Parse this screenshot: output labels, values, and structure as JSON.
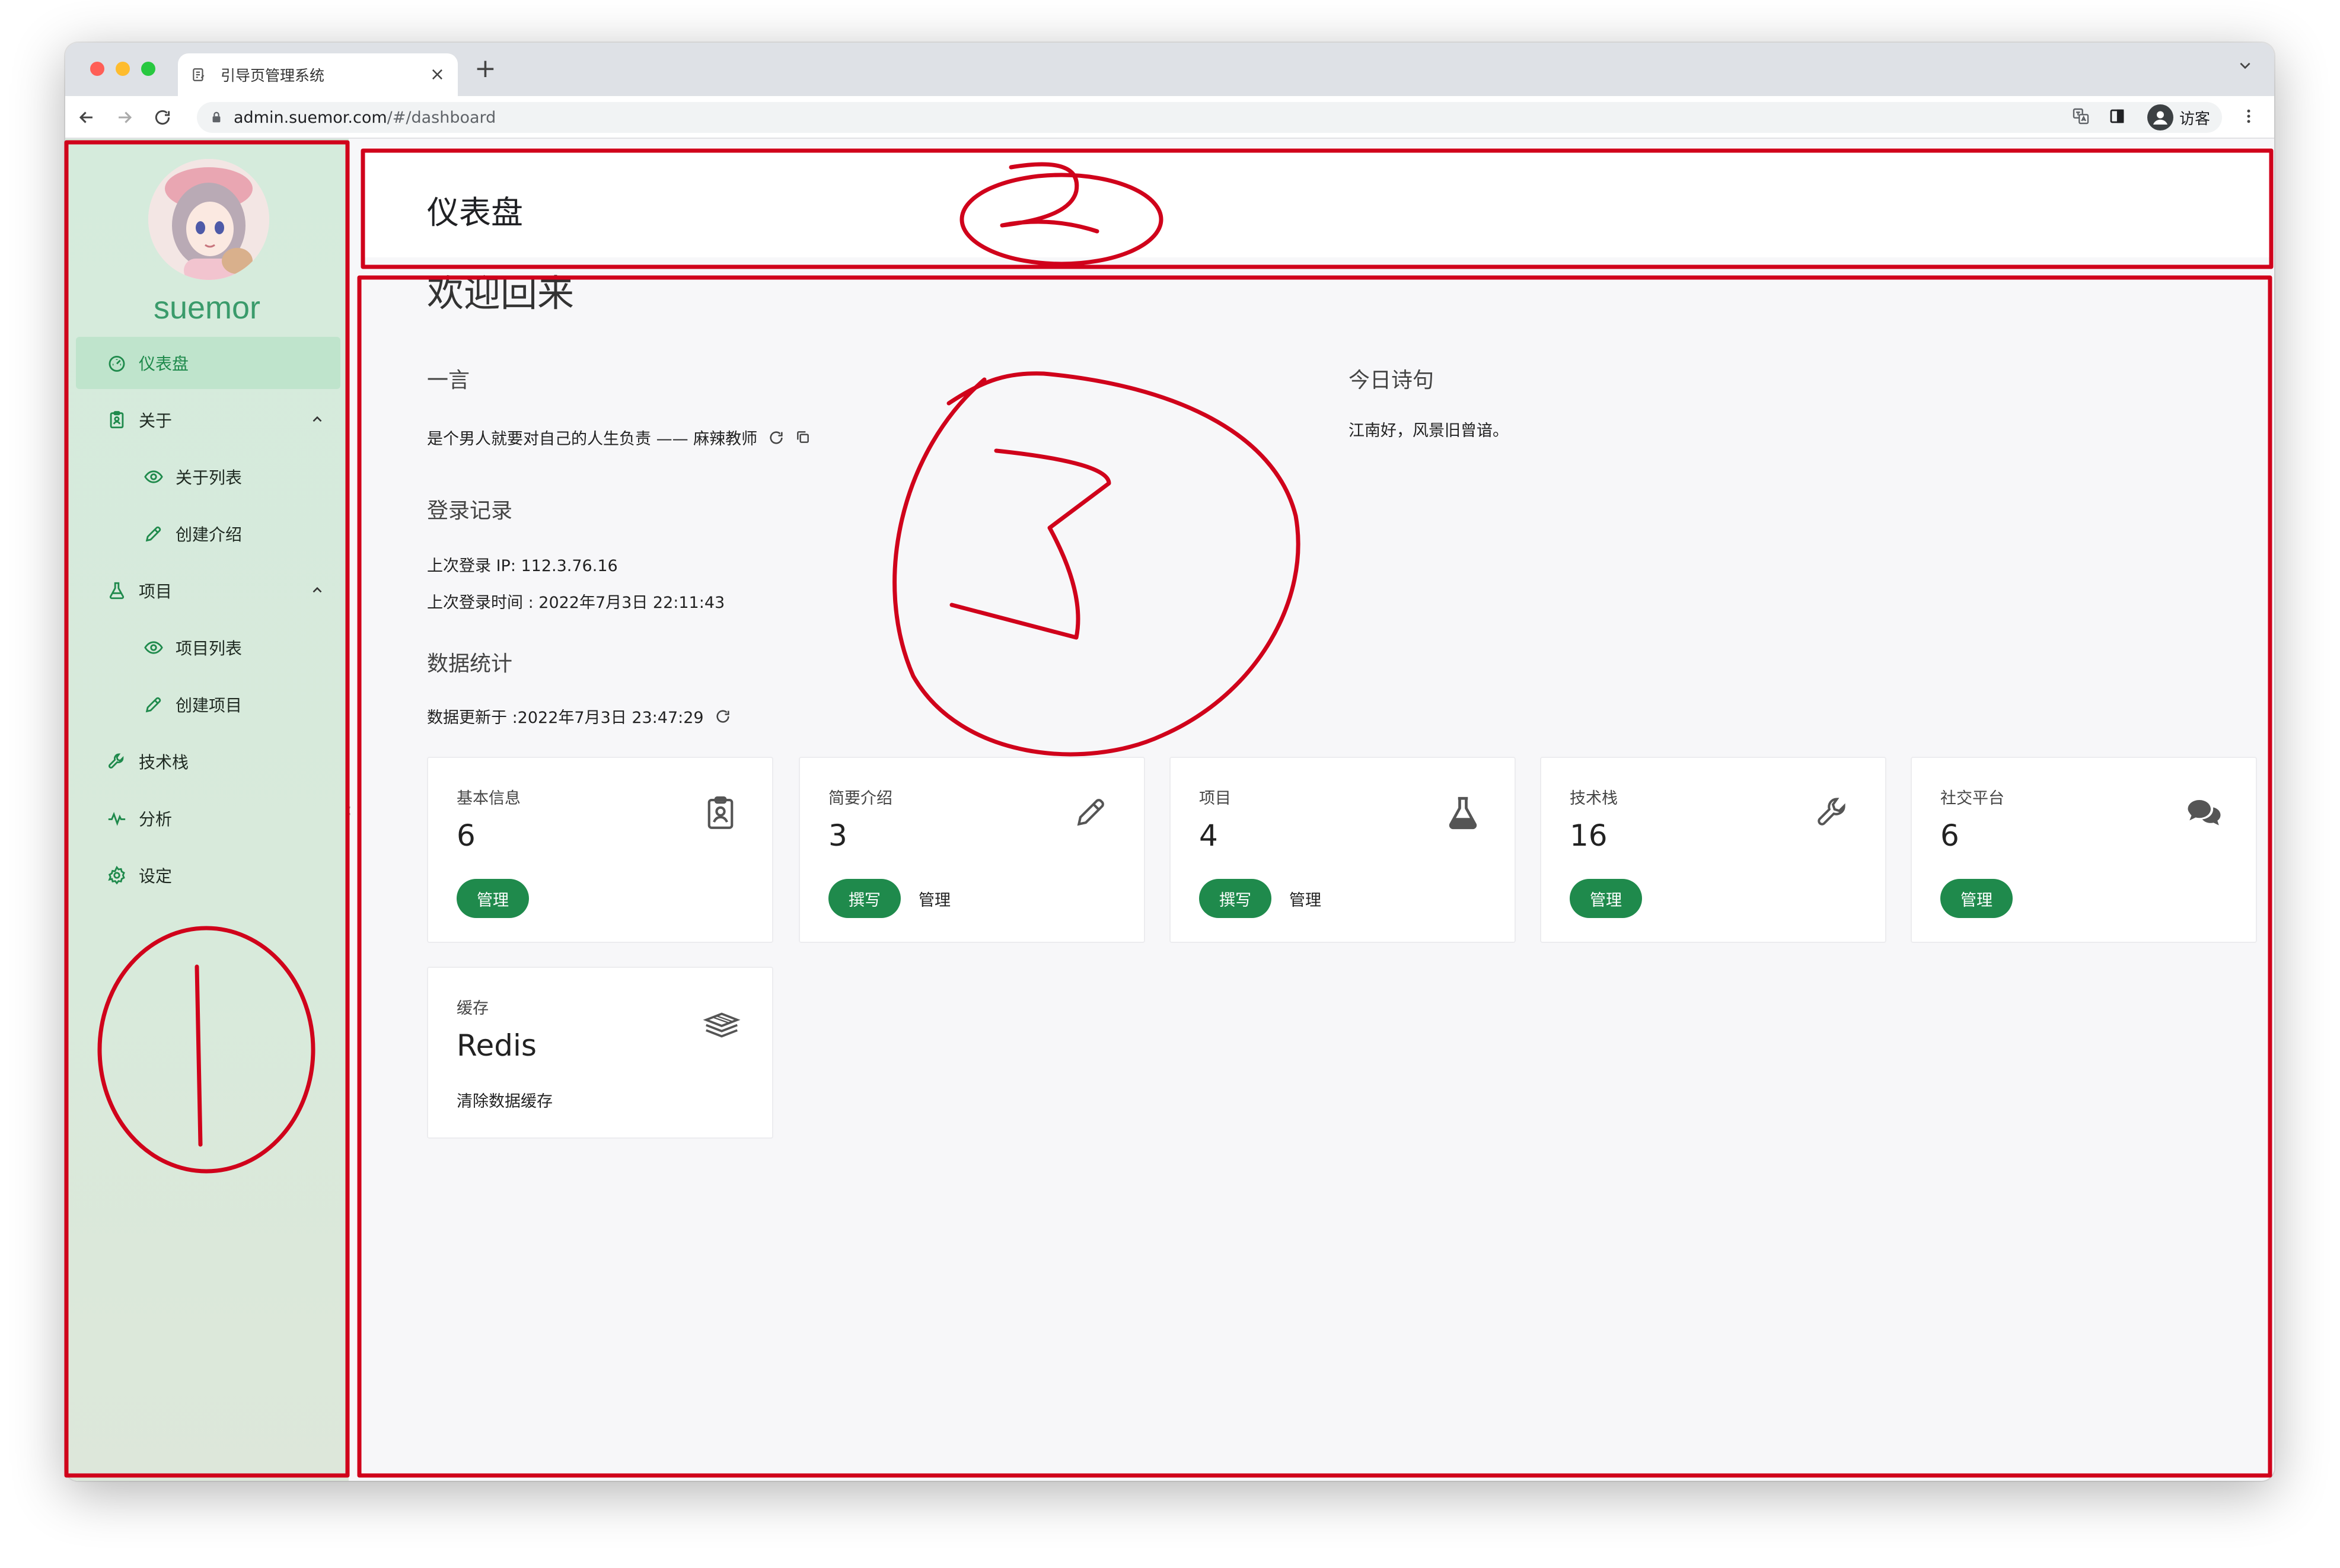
{
  "browser": {
    "tab_title": "引导页管理系统",
    "url_host": "admin.suemor.com",
    "url_path": "/#/dashboard",
    "profile_label": "访客"
  },
  "sidebar": {
    "username": "suemor",
    "items": [
      {
        "label": "仪表盘",
        "icon": "dashboard-icon",
        "active": true
      },
      {
        "label": "关于",
        "icon": "clipboard-icon",
        "expanded": true
      },
      {
        "label": "关于列表",
        "icon": "eye-icon",
        "sub": true
      },
      {
        "label": "创建介绍",
        "icon": "pencil-icon",
        "sub": true
      },
      {
        "label": "项目",
        "icon": "flask-icon",
        "expanded": true
      },
      {
        "label": "项目列表",
        "icon": "eye-icon",
        "sub": true
      },
      {
        "label": "创建项目",
        "icon": "pencil-icon",
        "sub": true
      },
      {
        "label": "技术栈",
        "icon": "wrench-icon"
      },
      {
        "label": "分析",
        "icon": "pulse-icon"
      },
      {
        "label": "设定",
        "icon": "gear-icon"
      }
    ]
  },
  "header": {
    "title": "仪表盘"
  },
  "main": {
    "welcome": "欢迎回来",
    "hitokoto": {
      "title": "一言",
      "text": "是个男人就要对自己的人生负责 —— 麻辣教师"
    },
    "poem": {
      "title": "今日诗句",
      "text": "江南好，风景旧曾谙。"
    },
    "login": {
      "title": "登录记录",
      "ip_line": "上次登录 IP: 112.3.76.16",
      "time_line": "上次登录时间 : 2022年7月3日 22:11:43"
    },
    "stats": {
      "title": "数据统计",
      "updated": "数据更新于 :2022年7月3日 23:47:29"
    },
    "cards": [
      {
        "label": "基本信息",
        "value": "6",
        "icon": "id-badge-icon",
        "primary": "管理",
        "secondary": ""
      },
      {
        "label": "简要介绍",
        "value": "3",
        "icon": "pencil-icon",
        "primary": "撰写",
        "secondary": "管理"
      },
      {
        "label": "项目",
        "value": "4",
        "icon": "flask-icon",
        "primary": "撰写",
        "secondary": "管理"
      },
      {
        "label": "技术栈",
        "value": "16",
        "icon": "wrench-icon",
        "primary": "管理",
        "secondary": ""
      },
      {
        "label": "社交平台",
        "value": "6",
        "icon": "chat-bubbles-icon",
        "primary": "管理",
        "secondary": ""
      }
    ],
    "cache_card": {
      "label": "缓存",
      "value": "Redis",
      "icon": "layers-icon",
      "link": "清除数据缓存"
    }
  },
  "annotations": {
    "color": "#d0021b",
    "markers": [
      "1",
      "2",
      "3"
    ]
  },
  "colors": {
    "accent": "#1f8a4c",
    "sidebar_bg": "#d6ebdc",
    "active_bg": "#bfe4cc",
    "username": "#3a9b6b",
    "annotation": "#d0021b"
  }
}
